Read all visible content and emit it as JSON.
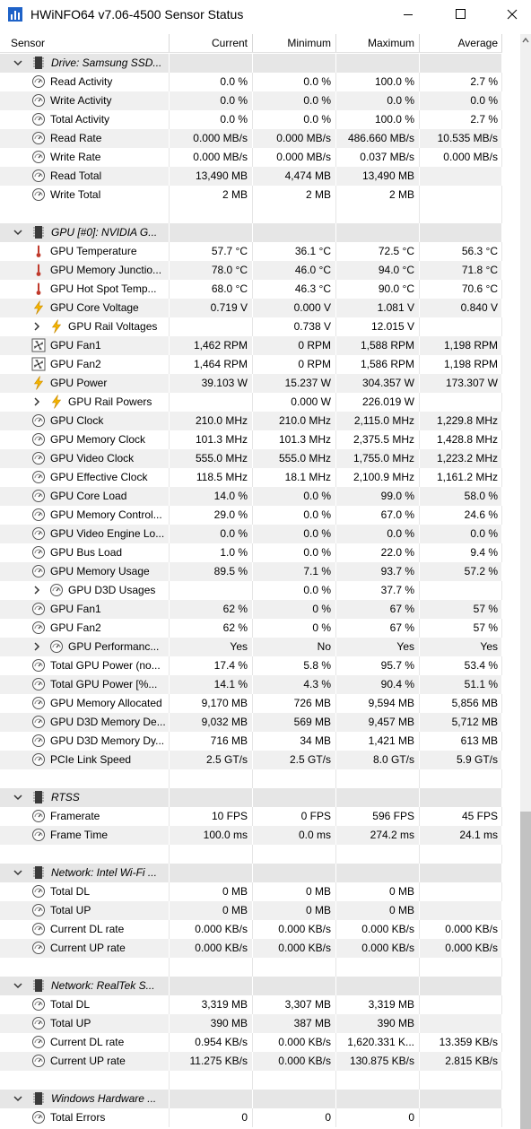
{
  "window": {
    "title": "HWiNFO64 v7.06-4500 Sensor Status",
    "icons": [
      "hwinfo-app-icon",
      "minimize-icon",
      "maximize-icon",
      "close-icon"
    ]
  },
  "columns": [
    "Sensor",
    "Current",
    "Minimum",
    "Maximum",
    "Average"
  ],
  "rows": [
    {
      "type": "group",
      "label": "Drive: Samsung SSD..."
    },
    {
      "type": "sensor",
      "icon": "gauge",
      "label": "Read Activity",
      "cur": "0.0 %",
      "min": "0.0 %",
      "max": "100.0 %",
      "avg": "2.7 %"
    },
    {
      "type": "sensor",
      "icon": "gauge",
      "label": "Write Activity",
      "cur": "0.0 %",
      "min": "0.0 %",
      "max": "0.0 %",
      "avg": "0.0 %"
    },
    {
      "type": "sensor",
      "icon": "gauge",
      "label": "Total Activity",
      "cur": "0.0 %",
      "min": "0.0 %",
      "max": "100.0 %",
      "avg": "2.7 %"
    },
    {
      "type": "sensor",
      "icon": "gauge",
      "label": "Read Rate",
      "cur": "0.000 MB/s",
      "min": "0.000 MB/s",
      "max": "486.660 MB/s",
      "avg": "10.535 MB/s"
    },
    {
      "type": "sensor",
      "icon": "gauge",
      "label": "Write Rate",
      "cur": "0.000 MB/s",
      "min": "0.000 MB/s",
      "max": "0.037 MB/s",
      "avg": "0.000 MB/s"
    },
    {
      "type": "sensor",
      "icon": "gauge",
      "label": "Read Total",
      "cur": "13,490 MB",
      "min": "4,474 MB",
      "max": "13,490 MB",
      "avg": ""
    },
    {
      "type": "sensor",
      "icon": "gauge",
      "label": "Write Total",
      "cur": "2 MB",
      "min": "2 MB",
      "max": "2 MB",
      "avg": ""
    },
    {
      "type": "blank"
    },
    {
      "type": "group",
      "label": "GPU [#0]: NVIDIA G..."
    },
    {
      "type": "sensor",
      "icon": "thermometer",
      "label": "GPU Temperature",
      "cur": "57.7 °C",
      "min": "36.1 °C",
      "max": "72.5 °C",
      "avg": "56.3 °C"
    },
    {
      "type": "sensor",
      "icon": "thermometer",
      "label": "GPU Memory Junctio...",
      "cur": "78.0 °C",
      "min": "46.0 °C",
      "max": "94.0 °C",
      "avg": "71.8 °C"
    },
    {
      "type": "sensor",
      "icon": "thermometer",
      "label": "GPU Hot Spot Temp...",
      "cur": "68.0 °C",
      "min": "46.3 °C",
      "max": "90.0 °C",
      "avg": "70.6 °C"
    },
    {
      "type": "sensor",
      "icon": "bolt",
      "label": "GPU Core Voltage",
      "cur": "0.719 V",
      "min": "0.000 V",
      "max": "1.081 V",
      "avg": "0.840 V"
    },
    {
      "type": "sub",
      "icon": "bolt",
      "label": "GPU Rail Voltages",
      "cur": "",
      "min": "0.738 V",
      "max": "12.015 V",
      "avg": ""
    },
    {
      "type": "sensor",
      "icon": "fan",
      "label": "GPU Fan1",
      "cur": "1,462 RPM",
      "min": "0 RPM",
      "max": "1,588 RPM",
      "avg": "1,198 RPM"
    },
    {
      "type": "sensor",
      "icon": "fan",
      "label": "GPU Fan2",
      "cur": "1,464 RPM",
      "min": "0 RPM",
      "max": "1,586 RPM",
      "avg": "1,198 RPM"
    },
    {
      "type": "sensor",
      "icon": "bolt",
      "label": "GPU Power",
      "cur": "39.103 W",
      "min": "15.237 W",
      "max": "304.357 W",
      "avg": "173.307 W"
    },
    {
      "type": "sub",
      "icon": "bolt",
      "label": "GPU Rail Powers",
      "cur": "",
      "min": "0.000 W",
      "max": "226.019 W",
      "avg": ""
    },
    {
      "type": "sensor",
      "icon": "gauge",
      "label": "GPU Clock",
      "cur": "210.0 MHz",
      "min": "210.0 MHz",
      "max": "2,115.0 MHz",
      "avg": "1,229.8 MHz"
    },
    {
      "type": "sensor",
      "icon": "gauge",
      "label": "GPU Memory Clock",
      "cur": "101.3 MHz",
      "min": "101.3 MHz",
      "max": "2,375.5 MHz",
      "avg": "1,428.8 MHz"
    },
    {
      "type": "sensor",
      "icon": "gauge",
      "label": "GPU Video Clock",
      "cur": "555.0 MHz",
      "min": "555.0 MHz",
      "max": "1,755.0 MHz",
      "avg": "1,223.2 MHz"
    },
    {
      "type": "sensor",
      "icon": "gauge",
      "label": "GPU Effective Clock",
      "cur": "118.5 MHz",
      "min": "18.1 MHz",
      "max": "2,100.9 MHz",
      "avg": "1,161.2 MHz"
    },
    {
      "type": "sensor",
      "icon": "gauge",
      "label": "GPU Core Load",
      "cur": "14.0 %",
      "min": "0.0 %",
      "max": "99.0 %",
      "avg": "58.0 %"
    },
    {
      "type": "sensor",
      "icon": "gauge",
      "label": "GPU Memory Control...",
      "cur": "29.0 %",
      "min": "0.0 %",
      "max": "67.0 %",
      "avg": "24.6 %"
    },
    {
      "type": "sensor",
      "icon": "gauge",
      "label": "GPU Video Engine Lo...",
      "cur": "0.0 %",
      "min": "0.0 %",
      "max": "0.0 %",
      "avg": "0.0 %"
    },
    {
      "type": "sensor",
      "icon": "gauge",
      "label": "GPU Bus Load",
      "cur": "1.0 %",
      "min": "0.0 %",
      "max": "22.0 %",
      "avg": "9.4 %"
    },
    {
      "type": "sensor",
      "icon": "gauge",
      "label": "GPU Memory Usage",
      "cur": "89.5 %",
      "min": "7.1 %",
      "max": "93.7 %",
      "avg": "57.2 %"
    },
    {
      "type": "sub",
      "icon": "gauge",
      "label": "GPU D3D Usages",
      "cur": "",
      "min": "0.0 %",
      "max": "37.7 %",
      "avg": ""
    },
    {
      "type": "sensor",
      "icon": "gauge",
      "label": "GPU Fan1",
      "cur": "62 %",
      "min": "0 %",
      "max": "67 %",
      "avg": "57 %"
    },
    {
      "type": "sensor",
      "icon": "gauge",
      "label": "GPU Fan2",
      "cur": "62 %",
      "min": "0 %",
      "max": "67 %",
      "avg": "57 %"
    },
    {
      "type": "sub",
      "icon": "gauge",
      "label": "GPU Performanc...",
      "cur": "Yes",
      "min": "No",
      "max": "Yes",
      "avg": "Yes"
    },
    {
      "type": "sensor",
      "icon": "gauge",
      "label": "Total GPU Power (no...",
      "cur": "17.4 %",
      "min": "5.8 %",
      "max": "95.7 %",
      "avg": "53.4 %"
    },
    {
      "type": "sensor",
      "icon": "gauge",
      "label": "Total GPU Power [%...",
      "cur": "14.1 %",
      "min": "4.3 %",
      "max": "90.4 %",
      "avg": "51.1 %"
    },
    {
      "type": "sensor",
      "icon": "gauge",
      "label": "GPU Memory Allocated",
      "cur": "9,170 MB",
      "min": "726 MB",
      "max": "9,594 MB",
      "avg": "5,856 MB"
    },
    {
      "type": "sensor",
      "icon": "gauge",
      "label": "GPU D3D Memory De...",
      "cur": "9,032 MB",
      "min": "569 MB",
      "max": "9,457 MB",
      "avg": "5,712 MB"
    },
    {
      "type": "sensor",
      "icon": "gauge",
      "label": "GPU D3D Memory Dy...",
      "cur": "716 MB",
      "min": "34 MB",
      "max": "1,421 MB",
      "avg": "613 MB"
    },
    {
      "type": "sensor",
      "icon": "gauge",
      "label": "PCIe Link Speed",
      "cur": "2.5 GT/s",
      "min": "2.5 GT/s",
      "max": "8.0 GT/s",
      "avg": "5.9 GT/s"
    },
    {
      "type": "blank"
    },
    {
      "type": "group",
      "label": "RTSS"
    },
    {
      "type": "sensor",
      "icon": "gauge",
      "label": "Framerate",
      "cur": "10 FPS",
      "min": "0 FPS",
      "max": "596 FPS",
      "avg": "45 FPS"
    },
    {
      "type": "sensor",
      "icon": "gauge",
      "label": "Frame Time",
      "cur": "100.0 ms",
      "min": "0.0 ms",
      "max": "274.2 ms",
      "avg": "24.1 ms"
    },
    {
      "type": "blank"
    },
    {
      "type": "group",
      "label": "Network: Intel Wi-Fi ..."
    },
    {
      "type": "sensor",
      "icon": "gauge",
      "label": "Total DL",
      "cur": "0 MB",
      "min": "0 MB",
      "max": "0 MB",
      "avg": ""
    },
    {
      "type": "sensor",
      "icon": "gauge",
      "label": "Total UP",
      "cur": "0 MB",
      "min": "0 MB",
      "max": "0 MB",
      "avg": ""
    },
    {
      "type": "sensor",
      "icon": "gauge",
      "label": "Current DL rate",
      "cur": "0.000 KB/s",
      "min": "0.000 KB/s",
      "max": "0.000 KB/s",
      "avg": "0.000 KB/s"
    },
    {
      "type": "sensor",
      "icon": "gauge",
      "label": "Current UP rate",
      "cur": "0.000 KB/s",
      "min": "0.000 KB/s",
      "max": "0.000 KB/s",
      "avg": "0.000 KB/s"
    },
    {
      "type": "blank"
    },
    {
      "type": "group",
      "label": "Network: RealTek S..."
    },
    {
      "type": "sensor",
      "icon": "gauge",
      "label": "Total DL",
      "cur": "3,319 MB",
      "min": "3,307 MB",
      "max": "3,319 MB",
      "avg": ""
    },
    {
      "type": "sensor",
      "icon": "gauge",
      "label": "Total UP",
      "cur": "390 MB",
      "min": "387 MB",
      "max": "390 MB",
      "avg": ""
    },
    {
      "type": "sensor",
      "icon": "gauge",
      "label": "Current DL rate",
      "cur": "0.954 KB/s",
      "min": "0.000 KB/s",
      "max": "1,620.331 K...",
      "avg": "13.359 KB/s"
    },
    {
      "type": "sensor",
      "icon": "gauge",
      "label": "Current UP rate",
      "cur": "11.275 KB/s",
      "min": "0.000 KB/s",
      "max": "130.875 KB/s",
      "avg": "2.815 KB/s"
    },
    {
      "type": "blank"
    },
    {
      "type": "group",
      "label": "Windows Hardware ..."
    },
    {
      "type": "sensor",
      "icon": "gauge",
      "label": "Total Errors",
      "cur": "0",
      "min": "0",
      "max": "0",
      "avg": ""
    }
  ]
}
